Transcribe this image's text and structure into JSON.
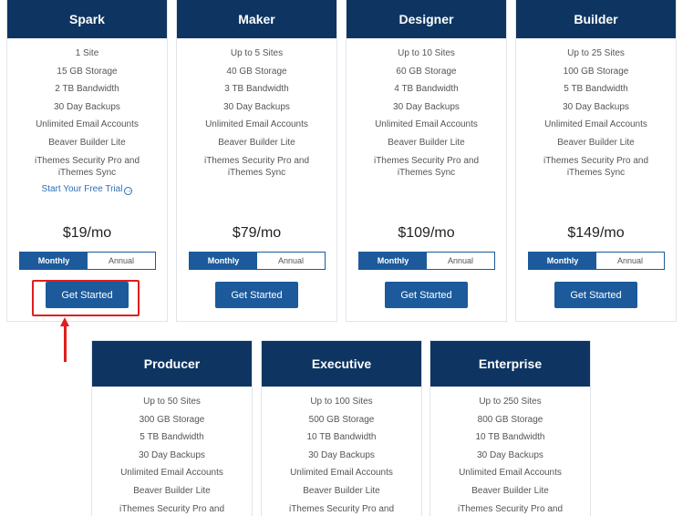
{
  "plans_top": [
    {
      "name": "Spark",
      "features": [
        "1 Site",
        "15 GB Storage",
        "2 TB Bandwidth",
        "30 Day Backups",
        "Unlimited Email Accounts",
        "Beaver Builder Lite",
        "iThemes Security Pro and iThemes Sync"
      ],
      "trial_link": "Start Your Free Trial",
      "price": "$19/mo",
      "toggle": {
        "monthly": "Monthly",
        "annual": "Annual"
      },
      "cta": "Get Started"
    },
    {
      "name": "Maker",
      "features": [
        "Up to 5 Sites",
        "40 GB Storage",
        "3 TB Bandwidth",
        "30 Day Backups",
        "Unlimited Email Accounts",
        "Beaver Builder Lite",
        "iThemes Security Pro and iThemes Sync"
      ],
      "price": "$79/mo",
      "toggle": {
        "monthly": "Monthly",
        "annual": "Annual"
      },
      "cta": "Get Started"
    },
    {
      "name": "Designer",
      "features": [
        "Up to 10 Sites",
        "60 GB Storage",
        "4 TB Bandwidth",
        "30 Day Backups",
        "Unlimited Email Accounts",
        "Beaver Builder Lite",
        "iThemes Security Pro and iThemes Sync"
      ],
      "price": "$109/mo",
      "toggle": {
        "monthly": "Monthly",
        "annual": "Annual"
      },
      "cta": "Get Started"
    },
    {
      "name": "Builder",
      "features": [
        "Up to 25 Sites",
        "100 GB Storage",
        "5 TB Bandwidth",
        "30 Day Backups",
        "Unlimited Email Accounts",
        "Beaver Builder Lite",
        "iThemes Security Pro and iThemes Sync"
      ],
      "price": "$149/mo",
      "toggle": {
        "monthly": "Monthly",
        "annual": "Annual"
      },
      "cta": "Get Started"
    }
  ],
  "plans_bottom": [
    {
      "name": "Producer",
      "features": [
        "Up to 50 Sites",
        "300 GB Storage",
        "5 TB Bandwidth",
        "30 Day Backups",
        "Unlimited Email Accounts",
        "Beaver Builder Lite",
        "iThemes Security Pro and"
      ]
    },
    {
      "name": "Executive",
      "features": [
        "Up to 100 Sites",
        "500 GB Storage",
        "10 TB Bandwidth",
        "30 Day Backups",
        "Unlimited Email Accounts",
        "Beaver Builder Lite",
        "iThemes Security Pro and"
      ]
    },
    {
      "name": "Enterprise",
      "features": [
        "Up to 250 Sites",
        "800 GB Storage",
        "10 TB Bandwidth",
        "30 Day Backups",
        "Unlimited Email Accounts",
        "Beaver Builder Lite",
        "iThemes Security Pro and"
      ]
    }
  ],
  "colors": {
    "header_bg": "#0e3562",
    "button_bg": "#1c5a9b",
    "annotation": "#e01e1e",
    "link": "#2d6fb3"
  }
}
